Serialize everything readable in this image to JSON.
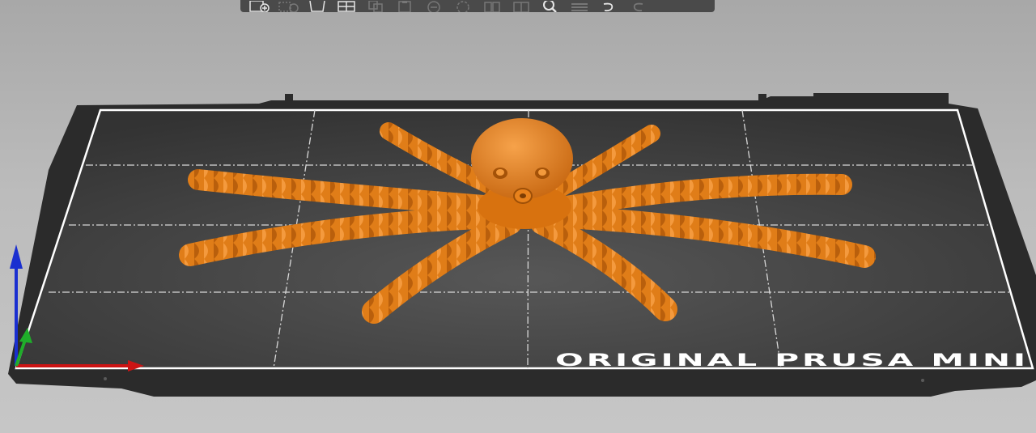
{
  "app": {
    "view": "3D plater"
  },
  "toolbar": {
    "items": [
      {
        "name": "add-icon",
        "enabled": true
      },
      {
        "name": "delete-icon",
        "enabled": false
      },
      {
        "name": "delete-all-icon",
        "enabled": true
      },
      {
        "name": "arrange-icon",
        "enabled": true
      },
      {
        "name": "copy-icon",
        "enabled": false
      },
      {
        "name": "paste-icon",
        "enabled": false
      },
      {
        "name": "add-instance-icon",
        "enabled": false
      },
      {
        "name": "remove-instance-icon",
        "enabled": false
      },
      {
        "name": "split-objects-icon",
        "enabled": false
      },
      {
        "name": "split-parts-icon",
        "enabled": false
      },
      {
        "name": "search-icon",
        "enabled": true
      },
      {
        "name": "layers-editing-icon",
        "enabled": false
      },
      {
        "name": "undo-icon",
        "enabled": true
      },
      {
        "name": "redo-icon",
        "enabled": false
      }
    ]
  },
  "bed": {
    "label": "ORIGINAL PRUSA MINI",
    "surface_color": "#3a3a3a",
    "frame_color": "#2a2a2a",
    "grid_color": "#d8d8d8"
  },
  "model": {
    "color": "#e8821c"
  },
  "axes": {
    "x_color": "#cc1414",
    "y_color": "#1fae2a",
    "z_color": "#1a2fd0"
  }
}
